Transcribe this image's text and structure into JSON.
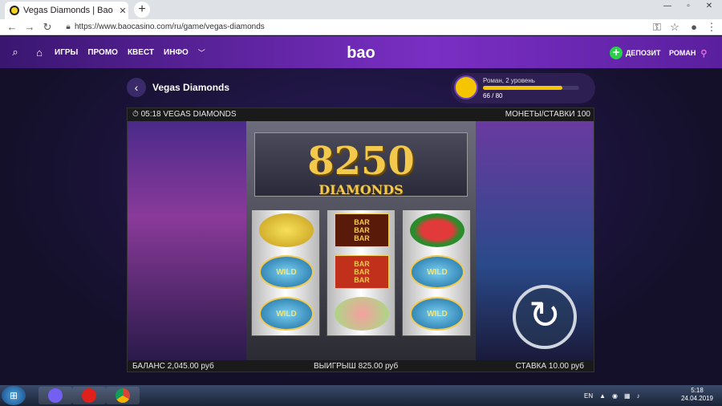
{
  "browser": {
    "tab_title": "Vegas Diamonds | Baocasino",
    "close_glyph": "✕",
    "new_tab_glyph": "+",
    "url": "https://www.baocasino.com/ru/game/vegas-diamonds"
  },
  "site_nav": {
    "items": [
      "ИГРЫ",
      "ПРОМО",
      "КВЕСТ",
      "ИНФО"
    ],
    "logo": "bao",
    "deposit_label": "ДЕПОЗИТ",
    "user_label": "РОМАН"
  },
  "game_header": {
    "title": "Vegas Diamonds"
  },
  "player": {
    "name_level": "Роман, 2 уровень",
    "progress_text": "66 / 80",
    "progress_fraction": 0.825
  },
  "game": {
    "top_left": "⏱ 05:18 VEGAS DIAMONDS",
    "top_right": "МОНЕТЫ/СТАВКИ 100",
    "jackpot_value": "8250",
    "jackpot_label": "DIAMONDS",
    "balance": "БАЛАНС 2,045.00 руб",
    "win": "ВЫИГРЫШ 825.00 руб",
    "bet": "СТАВКА 10.00 руб",
    "reels": [
      [
        "lemon",
        "wild",
        "wild"
      ],
      [
        "bar3",
        "bar3-red",
        "grapefruit"
      ],
      [
        "melon",
        "wild",
        "wild"
      ]
    ],
    "bar_text": "BAR",
    "wild_text": "WILD"
  },
  "taskbar": {
    "lang": "EN",
    "time": "5:18",
    "date": "24.04.2019"
  }
}
